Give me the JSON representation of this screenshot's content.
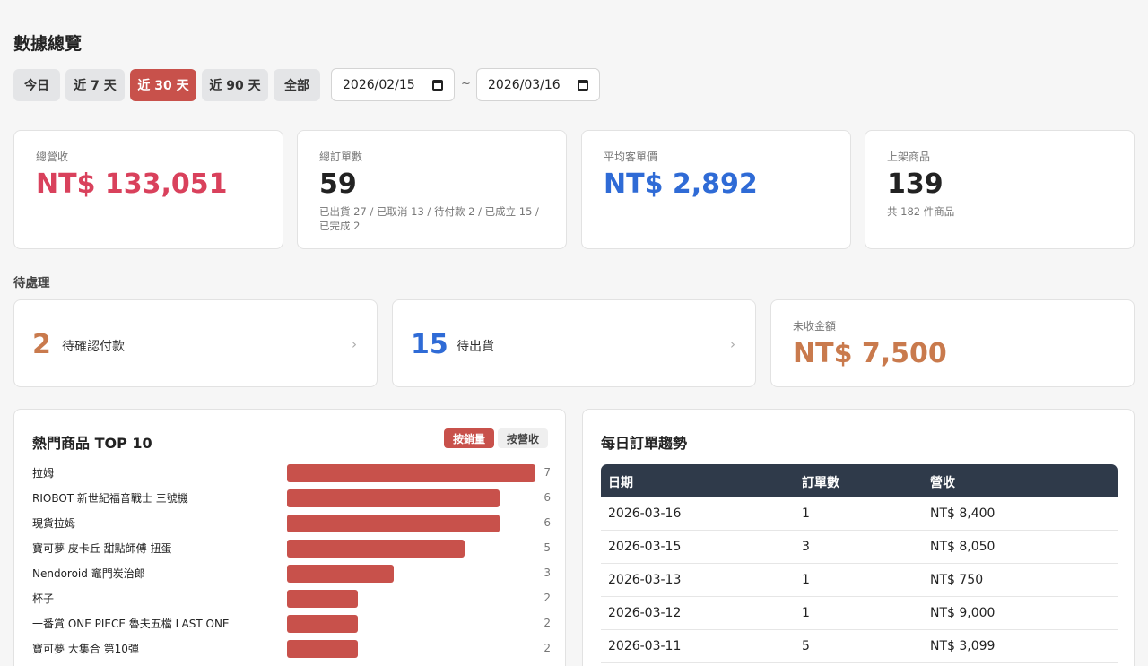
{
  "page_title": "數據總覽",
  "range_buttons": [
    "今日",
    "近 7 天",
    "近 30 天",
    "近 90 天",
    "全部"
  ],
  "active_range": "近 30 天",
  "date_from": "2026/02/15",
  "date_to": "2026/03/16",
  "date_sep": "~",
  "stats": [
    {
      "label": "總營收",
      "value": "NT$ 133,051",
      "sub": "",
      "color": "#d9415c"
    },
    {
      "label": "總訂單數",
      "value": "59",
      "sub": "已出貨 27 / 已取消 13 / 待付款 2 / 已成立 15 / 已完成 2",
      "color": "#222222"
    },
    {
      "label": "平均客單價",
      "value": "NT$ 2,892",
      "sub": "",
      "color": "#2f6bd6"
    },
    {
      "label": "上架商品",
      "value": "139",
      "sub": "共 182 件商品",
      "color": "#222222"
    }
  ],
  "pending_section_label": "待處理",
  "pending": {
    "confirm_payment": {
      "count": "2",
      "label": "待確認付款",
      "color": "#c97a4d"
    },
    "to_ship": {
      "count": "15",
      "label": "待出貨",
      "color": "#2f6bd6"
    },
    "unpaid": {
      "label": "未收金額",
      "value": "NT$ 7,500",
      "color": "#c97a4d"
    }
  },
  "top_products": {
    "title": "熱門商品 TOP 10",
    "toggle_sales": "按銷量",
    "toggle_revenue": "按營收",
    "accent": "#c8514b"
  },
  "chart_data": {
    "type": "bar",
    "orientation": "horizontal",
    "categories": [
      "拉姆",
      "RIOBOT 新世紀福音戰士 三號機",
      "現貨拉姆",
      "寶可夢 皮卡丘 甜點師傅 扭蛋",
      "Nendoroid 竈門炭治郎",
      "杯子",
      "一番賞 ONE PIECE 魯夫五檔 LAST ONE",
      "寶可夢 大集合 第10彈"
    ],
    "values": [
      7,
      6,
      6,
      5,
      3,
      2,
      2,
      2
    ],
    "xlim": [
      0,
      7
    ]
  },
  "daily_orders": {
    "title": "每日訂單趨勢",
    "columns": [
      "日期",
      "訂單數",
      "營收"
    ],
    "rows": [
      [
        "2026-03-16",
        "1",
        "NT$ 8,400"
      ],
      [
        "2026-03-15",
        "3",
        "NT$ 8,050"
      ],
      [
        "2026-03-13",
        "1",
        "NT$ 750"
      ],
      [
        "2026-03-12",
        "1",
        "NT$ 9,000"
      ],
      [
        "2026-03-11",
        "5",
        "NT$ 3,099"
      ]
    ]
  }
}
